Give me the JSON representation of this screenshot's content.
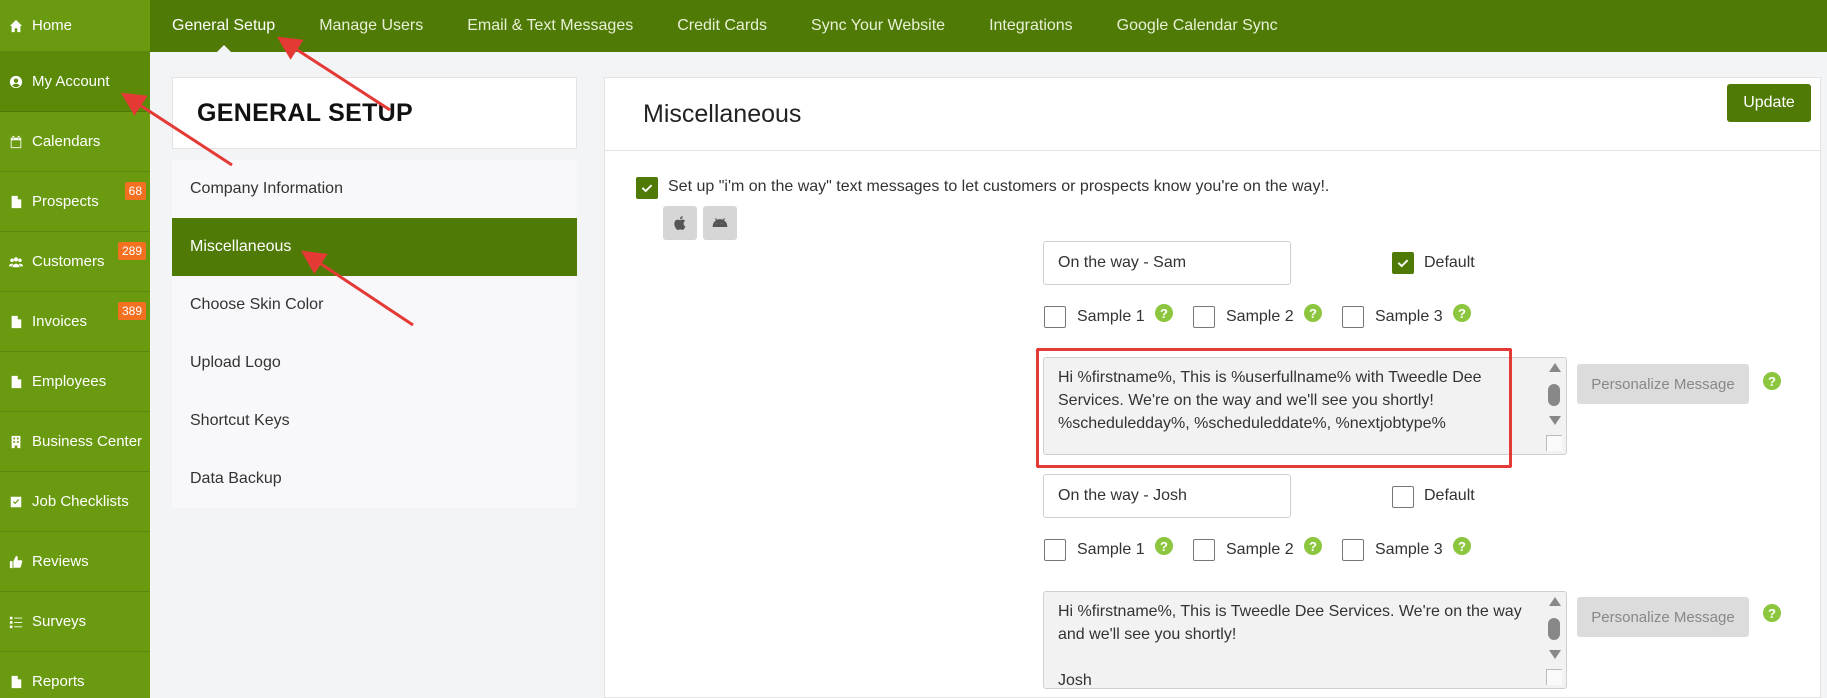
{
  "sidebar": {
    "items": [
      {
        "label": "Home",
        "icon": "home-icon"
      },
      {
        "label": "My Account",
        "icon": "user-circle-icon"
      },
      {
        "label": "Calendars",
        "icon": "calendar-icon"
      },
      {
        "label": "Prospects",
        "icon": "file-icon",
        "badge": "68"
      },
      {
        "label": "Customers",
        "icon": "users-icon",
        "badge": "289"
      },
      {
        "label": "Invoices",
        "icon": "file-icon",
        "badge": "389"
      },
      {
        "label": "Employees",
        "icon": "file-icon"
      },
      {
        "label": "Business Center",
        "icon": "building-icon"
      },
      {
        "label": "Job Checklists",
        "icon": "check-square-icon"
      },
      {
        "label": "Reviews",
        "icon": "thumbs-up-icon"
      },
      {
        "label": "Surveys",
        "icon": "list-icon"
      },
      {
        "label": "Reports",
        "icon": "file-icon"
      }
    ]
  },
  "topnav": {
    "items": [
      "General Setup",
      "Manage Users",
      "Email & Text Messages",
      "Credit Cards",
      "Sync Your Website",
      "Integrations",
      "Google Calendar Sync"
    ],
    "active": "General Setup"
  },
  "setup": {
    "title": "GENERAL SETUP",
    "items": [
      "Company Information",
      "Miscellaneous",
      "Choose Skin Color",
      "Upload Logo",
      "Shortcut Keys",
      "Data Backup"
    ],
    "active": "Miscellaneous"
  },
  "misc": {
    "title": "Miscellaneous",
    "update_label": "Update",
    "otw_label": "Set up \"i'm on the way\" text messages to let customers or prospects know you're on the way!.",
    "otw_enabled": true,
    "os_icons": [
      "apple-icon",
      "android-icon"
    ],
    "messages": [
      {
        "name": "On the way - Sam",
        "default_label": "Default",
        "default_checked": true,
        "samples": [
          "Sample 1",
          "Sample 2",
          "Sample 3"
        ],
        "text": "Hi %firstname%, This is %userfullname% with Tweedle Dee Services. We're on the way and we'll see you shortly! %scheduledday%, %scheduleddate%, %nextjobtype%",
        "personalize_label": "Personalize Message"
      },
      {
        "name": "On the way - Josh",
        "default_label": "Default",
        "default_checked": false,
        "samples": [
          "Sample 1",
          "Sample 2",
          "Sample 3"
        ],
        "text": "Hi %firstname%, This is Tweedle Dee Services. We're on the way and we'll see you shortly!\n\nJosh",
        "personalize_label": "Personalize Message"
      }
    ]
  },
  "colors": {
    "sidebar": "#6a9a10",
    "topnav": "#4f7a06",
    "accent": "#4f7a06",
    "badge": "#f37021",
    "help": "#8cc63f",
    "annotation": "#e53935"
  }
}
